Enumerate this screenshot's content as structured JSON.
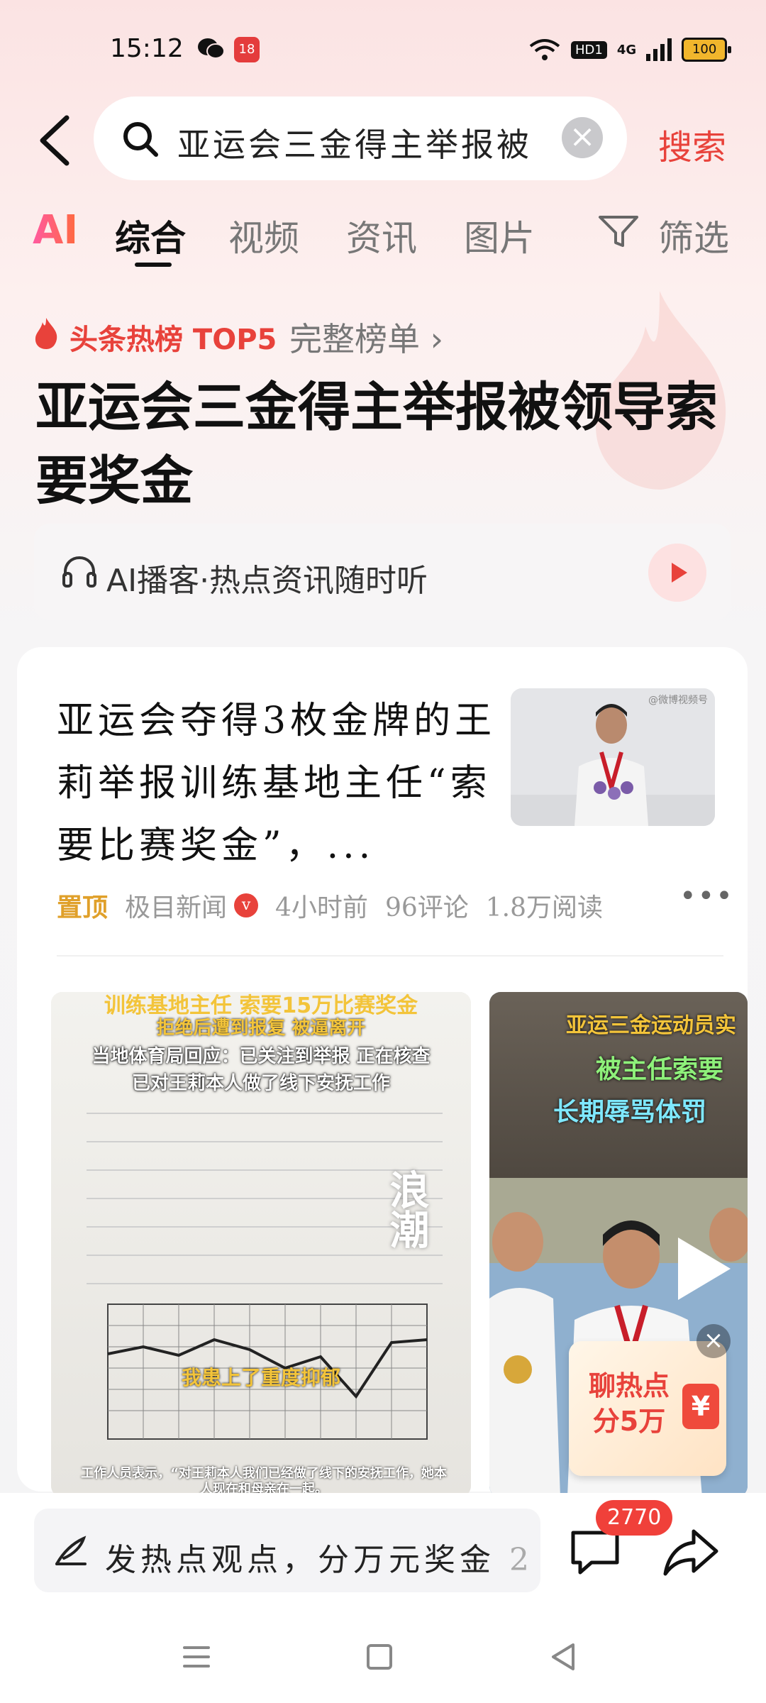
{
  "status_bar": {
    "time": "15:12",
    "app_badge": "18",
    "network": "HD1",
    "signal": "4G",
    "battery": "100"
  },
  "search": {
    "query": "亚运会三金得主举报被",
    "button_label": "搜索"
  },
  "tabs": {
    "ai_label": "AI",
    "items": [
      {
        "label": "综合",
        "active": true
      },
      {
        "label": "视频",
        "active": false
      },
      {
        "label": "资讯",
        "active": false
      },
      {
        "label": "图片",
        "active": false
      }
    ],
    "filter_label": "筛选"
  },
  "hot": {
    "label": "头条热榜 TOP5",
    "more_label": "完整榜单 ›",
    "headline": "亚运会三金得主举报被领导索要奖金",
    "podcast_label": "AI播客·热点资讯随时听"
  },
  "article": {
    "title": "亚运会夺得3枚金牌的王莉举报训练基地主任“索要比赛奖金”，...",
    "pin_label": "置顶",
    "source": "极目新闻",
    "time": "4小时前",
    "comments": "96评论",
    "reads": "1.8万阅读",
    "thumb_watermark": "@微博视频号"
  },
  "media": {
    "left_caption_1": "训练基地主任  索要15万比赛奖金",
    "left_caption_2": "拒绝后遭到报复 被逼离开",
    "left_caption_3": "当地体育局回应：已关注到举报 正在核查",
    "left_caption_4": "已对王莉本人做了线下安抚工作",
    "left_caption_5": "我患上了重度抑郁",
    "left_caption_6": "工作人员表示，“对王莉本人我们已经做了线下的安抚工作，她本人现在和母亲在一起。",
    "left_watermark": "浪潮",
    "right_caption_1": "亚运三金运动员实",
    "right_caption_2": "被主任索要",
    "right_caption_3": "长期辱骂体罚"
  },
  "reward": {
    "text": "聊热点分5万",
    "yen": "¥"
  },
  "bottom": {
    "comment_placeholder": "发热点观点，分万元奖金",
    "comment_suffix": "2.",
    "comment_count": "2770"
  },
  "colors": {
    "accent": "#e8423b",
    "pin": "#e0a02a"
  }
}
